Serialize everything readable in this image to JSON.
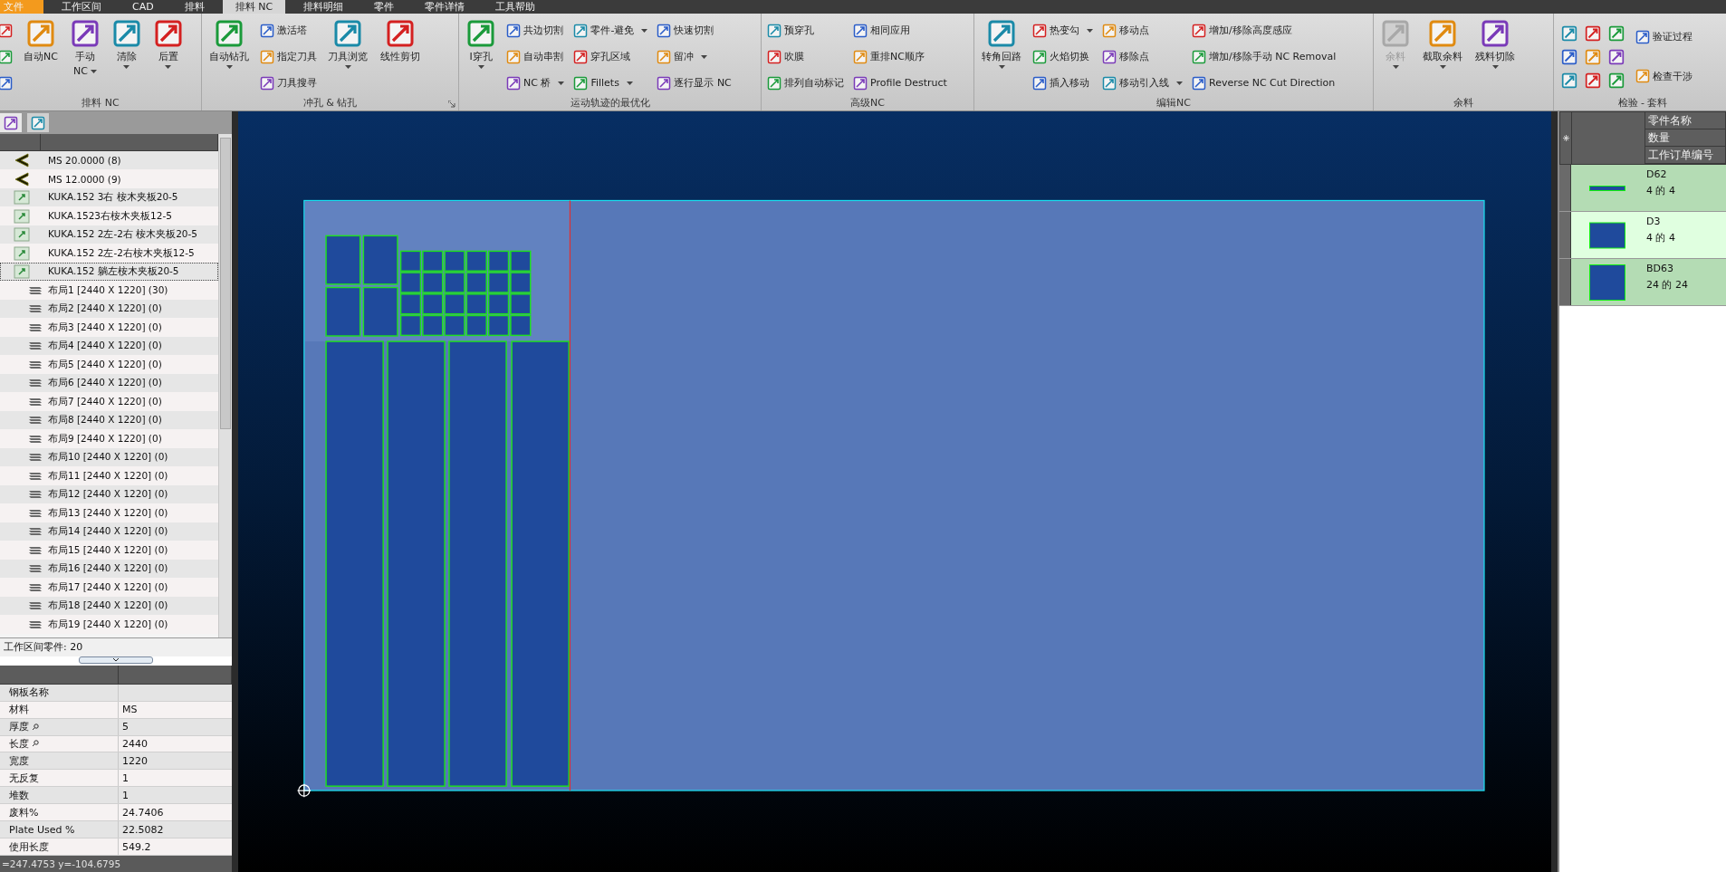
{
  "tabs": [
    {
      "label": "文件",
      "kind": "file",
      "selected": false
    },
    {
      "label": "工作区间",
      "kind": "tab",
      "selected": false
    },
    {
      "label": "CAD",
      "kind": "tab",
      "selected": false
    },
    {
      "label": "排料",
      "kind": "tab",
      "selected": false
    },
    {
      "label": "排料 NC",
      "kind": "tab",
      "selected": true
    },
    {
      "label": "排料明细",
      "kind": "tab",
      "selected": false
    },
    {
      "label": "零件",
      "kind": "tab",
      "selected": false
    },
    {
      "label": "零件详情",
      "kind": "tab",
      "selected": false
    },
    {
      "label": "工具帮助",
      "kind": "tab",
      "selected": false
    }
  ],
  "ribbon": {
    "groups": [
      {
        "label": "排料 NC",
        "launcher": false,
        "items": [
          {
            "kind": "icon_column"
          },
          {
            "kind": "large",
            "lines": [
              "自动NC"
            ],
            "dropdown": false,
            "disabled": false
          },
          {
            "kind": "large",
            "lines": [
              "手动",
              "NC"
            ],
            "dropdown": true,
            "disabled": false
          },
          {
            "kind": "large",
            "lines": [
              "清除"
            ],
            "dropdown": true,
            "disabled": false
          },
          {
            "kind": "large",
            "lines": [
              "后置"
            ],
            "dropdown": true,
            "disabled": false
          }
        ]
      },
      {
        "label": "冲孔 & 钻孔",
        "launcher": true,
        "items": [
          {
            "kind": "large",
            "lines": [
              "自动钻孔"
            ],
            "dropdown": true,
            "disabled": false
          },
          {
            "kind": "column",
            "buttons": [
              {
                "label": "激活塔",
                "dropdown": false
              },
              {
                "label": "指定刀具",
                "dropdown": false
              },
              {
                "label": "刀具搜寻",
                "dropdown": false
              }
            ]
          },
          {
            "kind": "large",
            "lines": [
              "刀具浏览"
            ],
            "dropdown": true,
            "disabled": false
          },
          {
            "kind": "large",
            "lines": [
              "线性剪切"
            ],
            "dropdown": false,
            "disabled": false
          }
        ]
      },
      {
        "label": "运动轨迹的最优化",
        "launcher": false,
        "items": [
          {
            "kind": "large",
            "lines": [
              "I穿孔"
            ],
            "dropdown": true,
            "disabled": false
          },
          {
            "kind": "column",
            "buttons": [
              {
                "label": "共边切割",
                "dropdown": false
              },
              {
                "label": "自动串割",
                "dropdown": false
              },
              {
                "label": "NC 桥",
                "dropdown": true
              }
            ]
          },
          {
            "kind": "column",
            "buttons": [
              {
                "label": "零件-避免",
                "dropdown": true
              },
              {
                "label": "穿孔区域",
                "dropdown": false
              },
              {
                "label": "Fillets",
                "dropdown": true
              }
            ]
          },
          {
            "kind": "column",
            "buttons": [
              {
                "label": "快速切割",
                "dropdown": false
              },
              {
                "label": "留冲",
                "dropdown": true
              },
              {
                "label": "逐行显示 NC",
                "dropdown": false
              }
            ]
          }
        ]
      },
      {
        "label": "高级NC",
        "launcher": false,
        "items": [
          {
            "kind": "column",
            "buttons": [
              {
                "label": "预穿孔",
                "dropdown": false
              },
              {
                "label": "吹膜",
                "dropdown": false
              },
              {
                "label": "排列自动标记",
                "dropdown": false
              }
            ]
          },
          {
            "kind": "column",
            "buttons": [
              {
                "label": "相同应用",
                "dropdown": false
              },
              {
                "label": "重排NC顺序",
                "dropdown": false
              },
              {
                "label": "Profile Destruct",
                "dropdown": false
              }
            ]
          }
        ]
      },
      {
        "label": "编辑NC",
        "launcher": false,
        "items": [
          {
            "kind": "large",
            "lines": [
              "转角回路"
            ],
            "dropdown": true,
            "disabled": false
          },
          {
            "kind": "column",
            "buttons": [
              {
                "label": "热变勾",
                "dropdown": true
              },
              {
                "label": "火焰切换",
                "dropdown": false
              },
              {
                "label": "插入移动",
                "dropdown": false
              }
            ]
          },
          {
            "kind": "column",
            "buttons": [
              {
                "label": "移动点",
                "dropdown": false
              },
              {
                "label": "移除点",
                "dropdown": false
              },
              {
                "label": "移动引入线",
                "dropdown": true
              }
            ]
          },
          {
            "kind": "column",
            "buttons": [
              {
                "label": "增加/移除高度感应",
                "dropdown": false
              },
              {
                "label": "增加/移除手动 NC Removal",
                "dropdown": false
              },
              {
                "label": "Reverse NC Cut Direction",
                "dropdown": false
              }
            ]
          }
        ]
      },
      {
        "label": "余料",
        "launcher": false,
        "items": [
          {
            "kind": "large",
            "lines": [
              "余料"
            ],
            "dropdown": true,
            "disabled": true
          },
          {
            "kind": "large",
            "lines": [
              "截取余料"
            ],
            "dropdown": true,
            "disabled": false
          },
          {
            "kind": "large",
            "lines": [
              "残料切除"
            ],
            "dropdown": true,
            "disabled": false
          }
        ]
      },
      {
        "label": "检验 - 套料",
        "launcher": false,
        "items": [
          {
            "kind": "icon_grid"
          },
          {
            "kind": "column",
            "buttons": [
              {
                "label": "验证过程",
                "dropdown": false
              },
              {
                "label": "检查干涉",
                "dropdown": false
              }
            ]
          }
        ]
      }
    ]
  },
  "left_panel": {
    "tree": [
      {
        "label": "MS 20.0000 (8)",
        "kind": "material",
        "selected": false
      },
      {
        "label": "MS 12.0000 (9)",
        "kind": "material",
        "selected": false
      },
      {
        "label": "KUKA.152 3右 桉木夹板20-5",
        "kind": "part",
        "selected": false
      },
      {
        "label": "KUKA.1523右桉木夹板12-5",
        "kind": "part",
        "selected": false
      },
      {
        "label": "KUKA.152 2左-2右 桉木夹板20-5",
        "kind": "part",
        "selected": false
      },
      {
        "label": "KUKA.152  2左-2右桉木夹板12-5",
        "kind": "part",
        "selected": false
      },
      {
        "label": "KUKA.152  躺左桉木夹板20-5",
        "kind": "part",
        "selected": true,
        "children": [
          {
            "label": "布局1 [2440 X 1220]  (30)",
            "kind": "layout",
            "selected": false
          },
          {
            "label": "布局2 [2440 X 1220]  (0)",
            "kind": "layout",
            "selected": false
          },
          {
            "label": "布局3 [2440 X 1220]  (0)",
            "kind": "layout",
            "selected": false
          },
          {
            "label": "布局4 [2440 X 1220]  (0)",
            "kind": "layout",
            "selected": false
          },
          {
            "label": "布局5 [2440 X 1220]  (0)",
            "kind": "layout",
            "selected": false
          },
          {
            "label": "布局6 [2440 X 1220]  (0)",
            "kind": "layout",
            "selected": false
          },
          {
            "label": "布局7 [2440 X 1220]  (0)",
            "kind": "layout",
            "selected": false
          },
          {
            "label": "布局8 [2440 X 1220]  (0)",
            "kind": "layout",
            "selected": false
          },
          {
            "label": "布局9 [2440 X 1220]  (0)",
            "kind": "layout",
            "selected": false
          },
          {
            "label": "布局10 [2440 X 1220]  (0)",
            "kind": "layout",
            "selected": false
          },
          {
            "label": "布局11 [2440 X 1220]  (0)",
            "kind": "layout",
            "selected": false
          },
          {
            "label": "布局12 [2440 X 1220]  (0)",
            "kind": "layout",
            "selected": false
          },
          {
            "label": "布局13 [2440 X 1220]  (0)",
            "kind": "layout",
            "selected": false
          },
          {
            "label": "布局14 [2440 X 1220]  (0)",
            "kind": "layout",
            "selected": false
          },
          {
            "label": "布局15 [2440 X 1220]  (0)",
            "kind": "layout",
            "selected": false
          },
          {
            "label": "布局16 [2440 X 1220]  (0)",
            "kind": "layout",
            "selected": false
          },
          {
            "label": "布局17 [2440 X 1220]  (0)",
            "kind": "layout",
            "selected": false
          },
          {
            "label": "布局18 [2440 X 1220]  (0)",
            "kind": "layout",
            "selected": false
          },
          {
            "label": "布局19 [2440 X 1220]  (0)",
            "kind": "layout",
            "selected": false
          }
        ]
      }
    ],
    "parts_info": "工作区间零件: 20",
    "properties": [
      {
        "label": "钢板名称",
        "lookup": false
      },
      {
        "label": "材料",
        "value": "MS",
        "lookup": false
      },
      {
        "label": "厚度",
        "value": "5",
        "lookup": true
      },
      {
        "label": "长度",
        "value": "2440",
        "lookup": true
      },
      {
        "label": "宽度",
        "value": "1220",
        "lookup": false
      },
      {
        "label": "无反复",
        "value": "1",
        "lookup": false
      },
      {
        "label": "堆数",
        "value": "1",
        "lookup": false
      },
      {
        "label": "废料%",
        "value": "24.7406",
        "lookup": false
      },
      {
        "label": "Plate Used %",
        "value": "22.5082",
        "lookup": false
      },
      {
        "label": "使用长度",
        "value": "549.2",
        "lookup": false
      }
    ],
    "status": "=247.4753 y=-104.6795"
  },
  "right_panel": {
    "headers": [
      "零件名称",
      "数量",
      "工作订单编号"
    ],
    "parts": [
      {
        "name": "D62",
        "count": "4 的 4",
        "kind": "strip"
      },
      {
        "name": "D3",
        "count": "4 的 4",
        "kind": "square"
      },
      {
        "name": "BD63",
        "count": "24 的 24",
        "kind": "square"
      }
    ]
  }
}
